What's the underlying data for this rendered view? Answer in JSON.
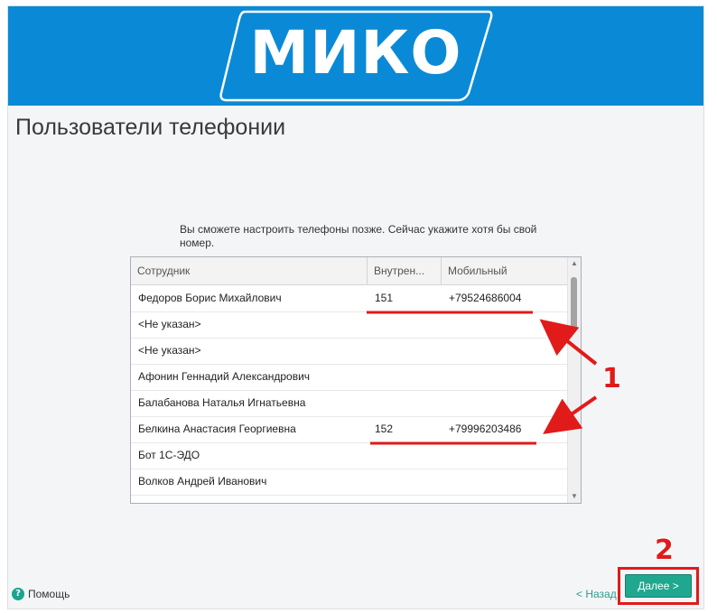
{
  "brand": {
    "logo_text": "МИКО",
    "banner_color": "#0a8ad6"
  },
  "page": {
    "title": "Пользователи телефонии",
    "hint": "Вы сможете настроить телефоны позже. Сейчас укажите хотя бы свой номер."
  },
  "table": {
    "columns": [
      "Сотрудник",
      "Внутрен...",
      "Мобильный"
    ],
    "rows": [
      {
        "name": "Федоров Борис Михайлович",
        "ext": "151",
        "mobile": "+79524686004"
      },
      {
        "name": "<Не указан>",
        "ext": "",
        "mobile": ""
      },
      {
        "name": "<Не указан>",
        "ext": "",
        "mobile": ""
      },
      {
        "name": "Афонин Геннадий Александрович",
        "ext": "",
        "mobile": ""
      },
      {
        "name": "Балабанова Наталья Игнатьевна",
        "ext": "",
        "mobile": ""
      },
      {
        "name": "Белкина Анастасия Георгиевна",
        "ext": "152",
        "mobile": "+79996203486"
      },
      {
        "name": "Бот 1С-ЭДО",
        "ext": "",
        "mobile": ""
      },
      {
        "name": "Волков Андрей Иванович",
        "ext": "",
        "mobile": ""
      }
    ]
  },
  "footer": {
    "help_icon": "question-icon",
    "help_label": "Помощь",
    "back_label": "< Назад",
    "next_label": "Далее >"
  },
  "annotations": {
    "marker_1": "1",
    "marker_2": "2",
    "color": "#e11a1a"
  }
}
